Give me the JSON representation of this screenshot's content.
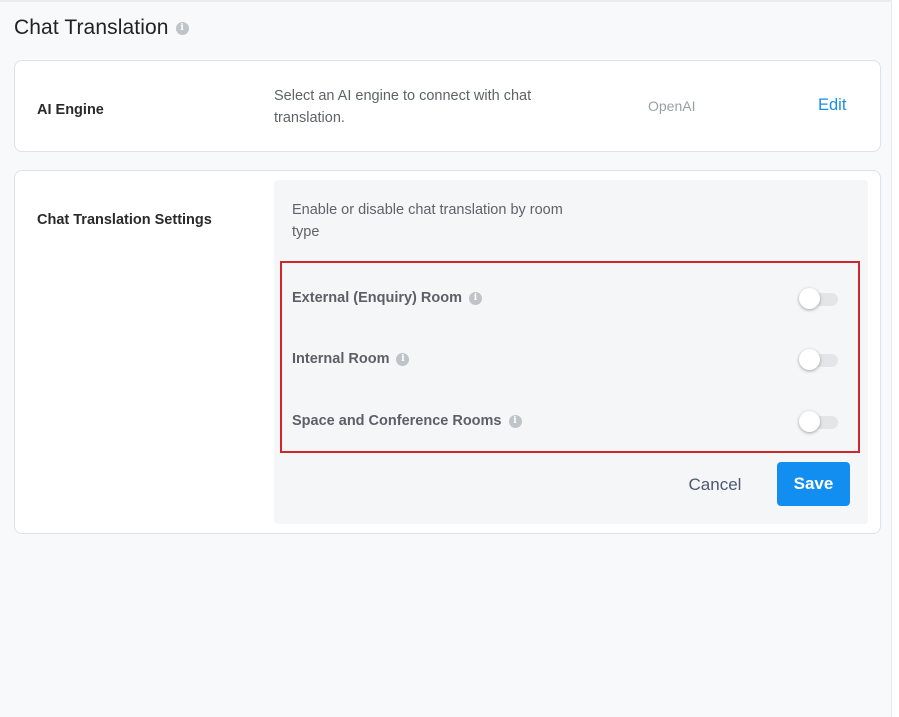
{
  "page": {
    "title": "Chat Translation",
    "title_info_icon": "info-icon"
  },
  "ai_engine": {
    "label": "AI Engine",
    "description": "Select an AI engine to connect with chat translation.",
    "value": "OpenAI",
    "edit_label": "Edit"
  },
  "settings": {
    "label": "Chat Translation Settings",
    "description": "Enable or disable chat translation by room type",
    "rooms": [
      {
        "label": "External (Enquiry) Room",
        "enabled": false,
        "icon": "info-icon"
      },
      {
        "label": "Internal Room",
        "enabled": false,
        "icon": "info-icon"
      },
      {
        "label": "Space and Conference Rooms",
        "enabled": false,
        "icon": "info-icon"
      }
    ],
    "cancel_label": "Cancel",
    "save_label": "Save"
  },
  "colors": {
    "accent": "#118ef0",
    "link": "#1a8de8",
    "highlight": "#d0262d",
    "background": "#f8f9fb"
  }
}
